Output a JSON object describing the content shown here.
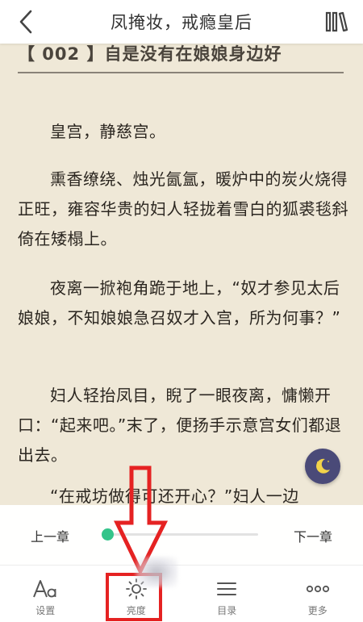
{
  "header": {
    "title": "凤掩妆，戒瘾皇后",
    "back_icon": "chevron-left-icon",
    "shelf_icon": "bookshelf-icon"
  },
  "content": {
    "chapter_heading": "【 002 】自是没有在娘娘身边好",
    "paragraphs": [
      "皇宫，静慈宫。",
      "熏香缭绕、烛光氤氲，暖炉中的炭火烧得正旺，雍容华贵的妇人轻拢着雪白的狐裘毯斜倚在矮榻上。",
      "夜离一掀袍角跪于地上，“奴才参见太后娘娘，不知娘娘急召奴才入宫，所为何事？”",
      "妇人轻抬凤目，睨了一眼夜离，慵懒开口：“起来吧。”末了，便扬手示意宫女们都退出去。",
      "“在戒坊做得可还开心？”妇人一边"
    ]
  },
  "night_mode": {
    "icon": "moon-icon",
    "color": "#4a4a78"
  },
  "progress": {
    "prev_label": "上一章",
    "next_label": "下一章",
    "value": 0.0,
    "accent": "#33c48a"
  },
  "toolbar": {
    "items": [
      {
        "label": "设置",
        "icon": "font-settings-icon"
      },
      {
        "label": "亮度",
        "icon": "brightness-icon"
      },
      {
        "label": "目录",
        "icon": "list-icon"
      },
      {
        "label": "更多",
        "icon": "more-icon"
      }
    ]
  },
  "annotation": {
    "color": "#e52222"
  }
}
